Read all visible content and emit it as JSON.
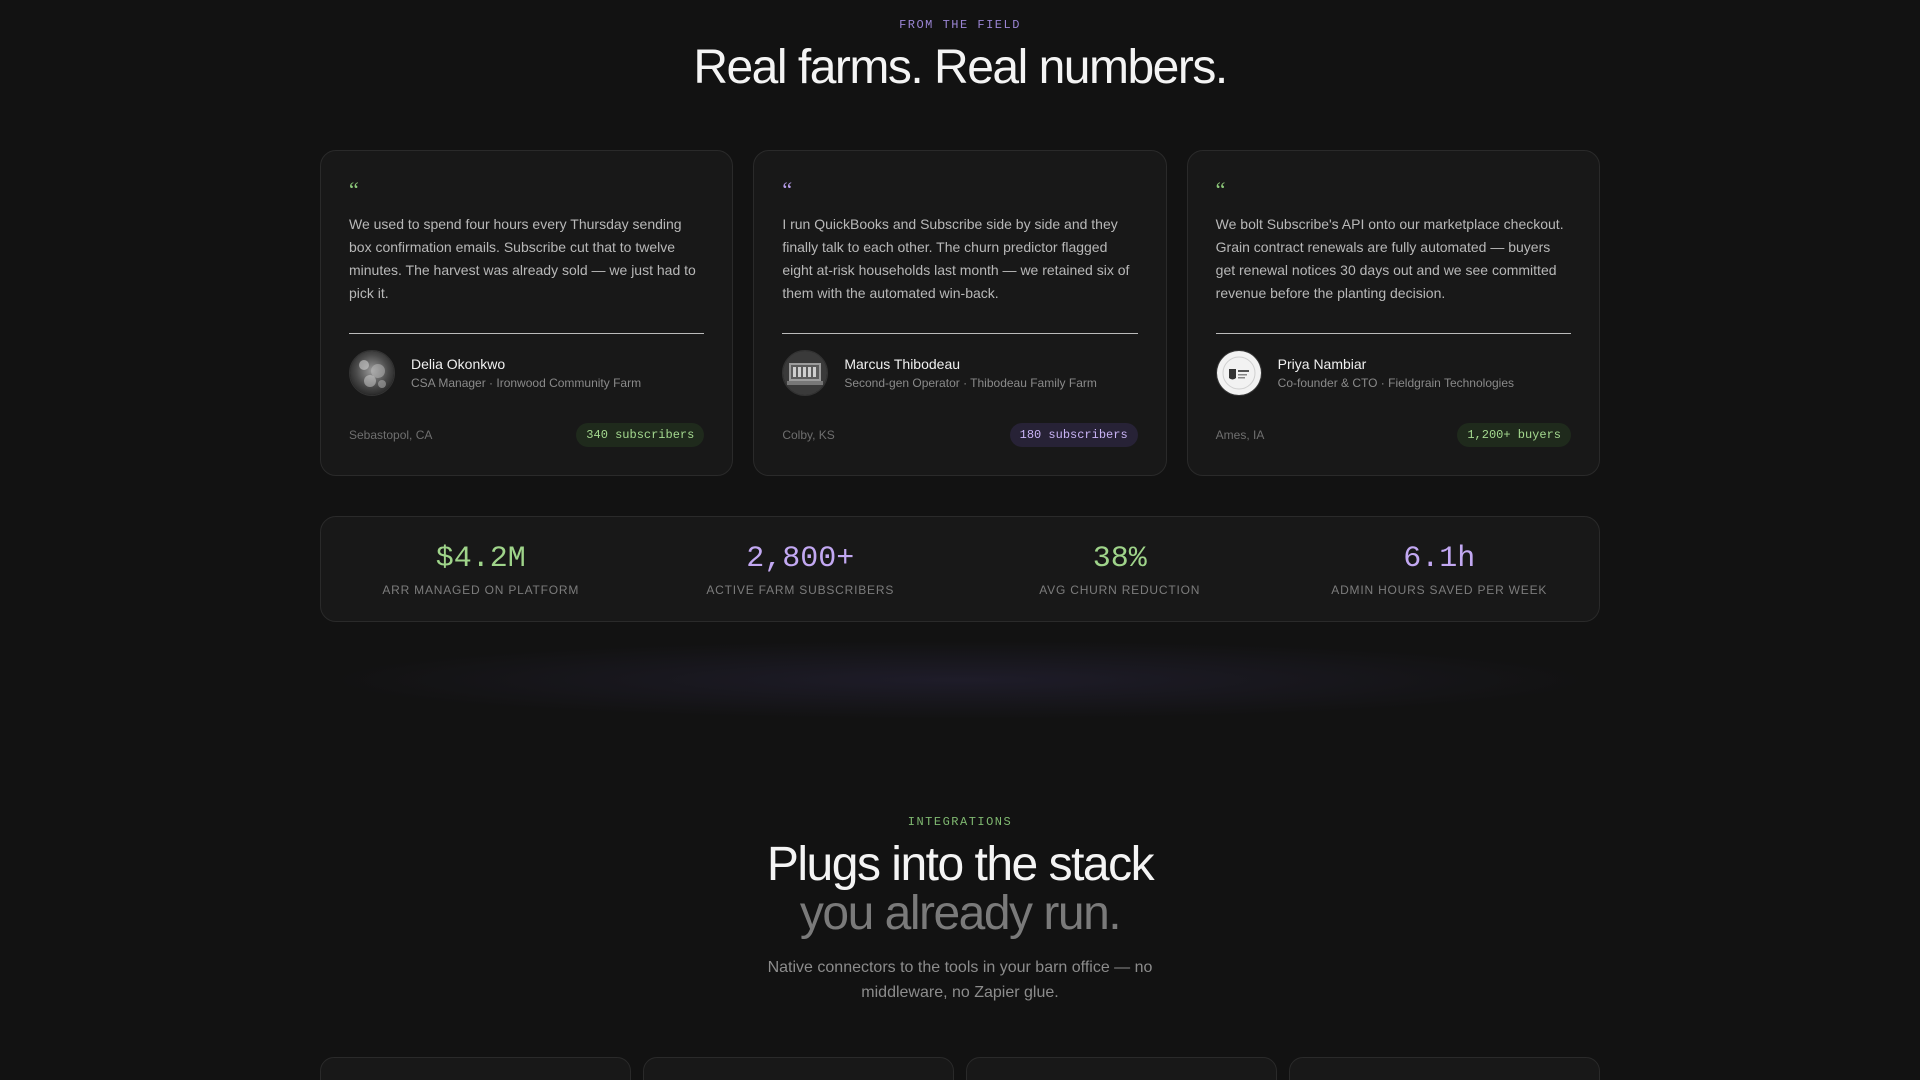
{
  "testimonials": {
    "eyebrow": "FROM THE FIELD",
    "title": "Real farms. Real numbers.",
    "cards": [
      {
        "quote_mark": "“",
        "quote": "We used to spend four hours every Thursday sending box confirmation emails. Subscribe cut that to twelve minutes. The harvest was already sold — we just had to pick it.",
        "name": "Delia Okonkwo",
        "role": "CSA Manager · Ironwood Community Farm",
        "location": "Sebastopol, CA",
        "badge": "340 subscribers",
        "accent": "#8dc97a"
      },
      {
        "quote_mark": "“",
        "quote": "I run QuickBooks and Subscribe side by side and they finally talk to each other. The churn predictor flagged eight at-risk households last month — we retained six of them with the automated win-back.",
        "name": "Marcus Thibodeau",
        "role": "Second-gen Operator · Thibodeau Family Farm",
        "location": "Colby, KS",
        "badge": "180 subscribers",
        "accent": "#b59ce8"
      },
      {
        "quote_mark": "“",
        "quote": "We bolt Subscribe's API onto our marketplace checkout. Grain contract renewals are fully automated — buyers get renewal notices 30 days out and we see committed revenue before the planting decision.",
        "name": "Priya Nambiar",
        "role": "Co-founder & CTO · Fieldgrain Technologies",
        "location": "Ames, IA",
        "badge": "1,200+ buyers",
        "accent": "#8dc97a"
      }
    ]
  },
  "stats": [
    {
      "value": "$4.2M",
      "label": "ARR MANAGED ON PLATFORM",
      "color": "#9fd48a"
    },
    {
      "value": "2,800+",
      "label": "ACTIVE FARM SUBSCRIBERS",
      "color": "#c2a8f2"
    },
    {
      "value": "38%",
      "label": "AVG CHURN REDUCTION",
      "color": "#9fd48a"
    },
    {
      "value": "6.1h",
      "label": "ADMIN HOURS SAVED PER WEEK",
      "color": "#c2a8f2"
    }
  ],
  "integrations": {
    "eyebrow": "INTEGRATIONS",
    "title_line1": "Plugs into the stack",
    "title_line2": "you already run.",
    "subtitle": "Native connectors to the tools in your barn office — no middleware, no Zapier glue."
  }
}
